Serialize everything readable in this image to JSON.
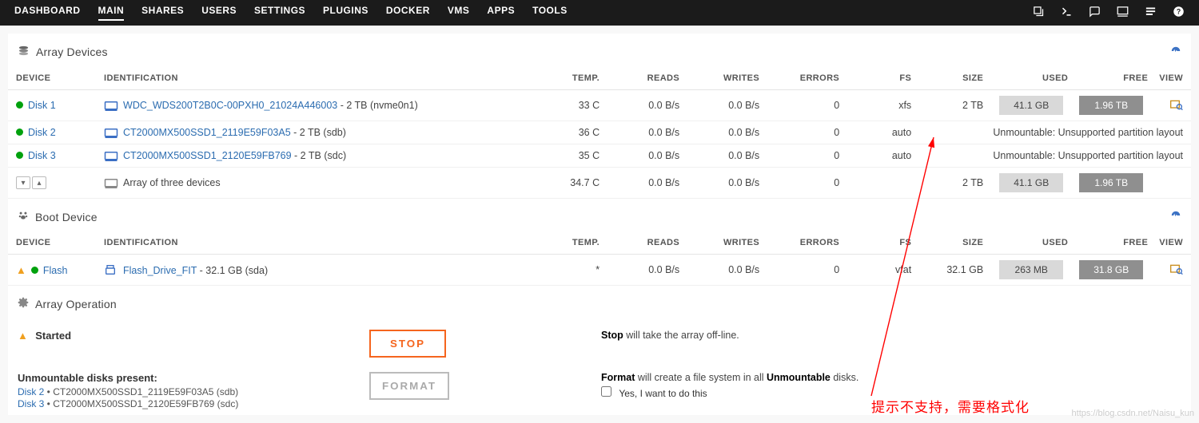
{
  "nav": {
    "items": [
      "DASHBOARD",
      "MAIN",
      "SHARES",
      "USERS",
      "SETTINGS",
      "PLUGINS",
      "DOCKER",
      "VMS",
      "APPS",
      "TOOLS"
    ],
    "active": 1
  },
  "sections": {
    "array": "Array Devices",
    "boot": "Boot Device",
    "op": "Array Operation"
  },
  "head": {
    "device": "DEVICE",
    "ident": "IDENTIFICATION",
    "temp": "TEMP.",
    "reads": "READS",
    "writes": "WRITES",
    "errors": "ERRORS",
    "fs": "FS",
    "size": "SIZE",
    "used": "USED",
    "free": "FREE",
    "view": "VIEW"
  },
  "array": [
    {
      "name": "Disk 1",
      "ident": "WDC_WDS200T2B0C-00PXH0_21024A446003",
      "tail": " - 2 TB (nvme0n1)",
      "temp": "33 C",
      "reads": "0.0 B/s",
      "writes": "0.0 B/s",
      "errors": "0",
      "fs": "xfs",
      "size": "2 TB",
      "used": "41.1 GB",
      "free": "1.96 TB",
      "err": null
    },
    {
      "name": "Disk 2",
      "ident": "CT2000MX500SSD1_2119E59F03A5",
      "tail": " - 2 TB (sdb)",
      "temp": "36 C",
      "reads": "0.0 B/s",
      "writes": "0.0 B/s",
      "errors": "0",
      "fs": "auto",
      "size": "",
      "used": "",
      "free": "",
      "err": "Unmountable: Unsupported partition layout"
    },
    {
      "name": "Disk 3",
      "ident": "CT2000MX500SSD1_2120E59FB769",
      "tail": " - 2 TB (sdc)",
      "temp": "35 C",
      "reads": "0.0 B/s",
      "writes": "0.0 B/s",
      "errors": "0",
      "fs": "auto",
      "size": "",
      "used": "",
      "free": "",
      "err": "Unmountable: Unsupported partition layout"
    }
  ],
  "array_total": {
    "ident": "Array of three devices",
    "temp": "34.7 C",
    "reads": "0.0 B/s",
    "writes": "0.0 B/s",
    "errors": "0",
    "size": "2 TB",
    "used": "41.1 GB",
    "free": "1.96 TB"
  },
  "boot": {
    "name": "Flash",
    "ident": "Flash_Drive_FIT",
    "tail": " - 32.1 GB (sda)",
    "temp": "*",
    "reads": "0.0 B/s",
    "writes": "0.0 B/s",
    "errors": "0",
    "fs": "vfat",
    "size": "32.1 GB",
    "used": "263 MB",
    "free": "31.8 GB"
  },
  "op": {
    "status": "Started",
    "stop_label": "STOP",
    "stop_note_b": "Stop",
    "stop_note_t": " will take the array off-line.",
    "format_label": "FORMAT",
    "format_note_b1": "Format",
    "format_note_t": " will create a file system in all ",
    "format_note_b2": "Unmountable",
    "format_note_t2": " disks.",
    "unmount_head": "Unmountable disks present:",
    "unmount": [
      {
        "link": "Disk 2",
        "t": " • CT2000MX500SSD1_2119E59F03A5 (sdb)"
      },
      {
        "link": "Disk 3",
        "t": " • CT2000MX500SSD1_2120E59FB769 (sdc)"
      }
    ],
    "check_label": "Yes, I want to do this"
  },
  "zh": "提示不支持，需要格式化",
  "watermark": "https://blog.csdn.net/Naisu_kun"
}
